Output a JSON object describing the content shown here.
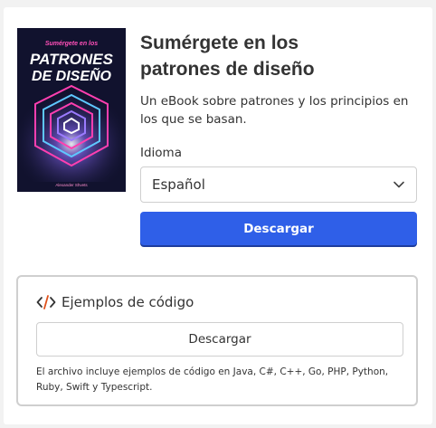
{
  "book": {
    "cover": {
      "tagline": "Sumérgete en los",
      "title_line1": "PATRONES",
      "title_line2": "DE DISEÑO",
      "author": "Alexander Shvets"
    },
    "title_line1": "Sumérgete en los",
    "title_line2": "patrones de diseño",
    "description": "Un eBook sobre patrones y los principios en los que se basan.",
    "language_label": "Idioma",
    "language_value": "Español",
    "download_label": "Descargar"
  },
  "code_examples": {
    "title": "Ejemplos de código",
    "download_label": "Descargar",
    "note": "El archivo incluye ejemplos de código en Java, C#, C++, Go, PHP, Python, Ruby, Swift y Typescript."
  },
  "colors": {
    "primary": "#2f5fe8",
    "cover_bg": "#11122e",
    "cover_accent": "#ff2fa6"
  }
}
